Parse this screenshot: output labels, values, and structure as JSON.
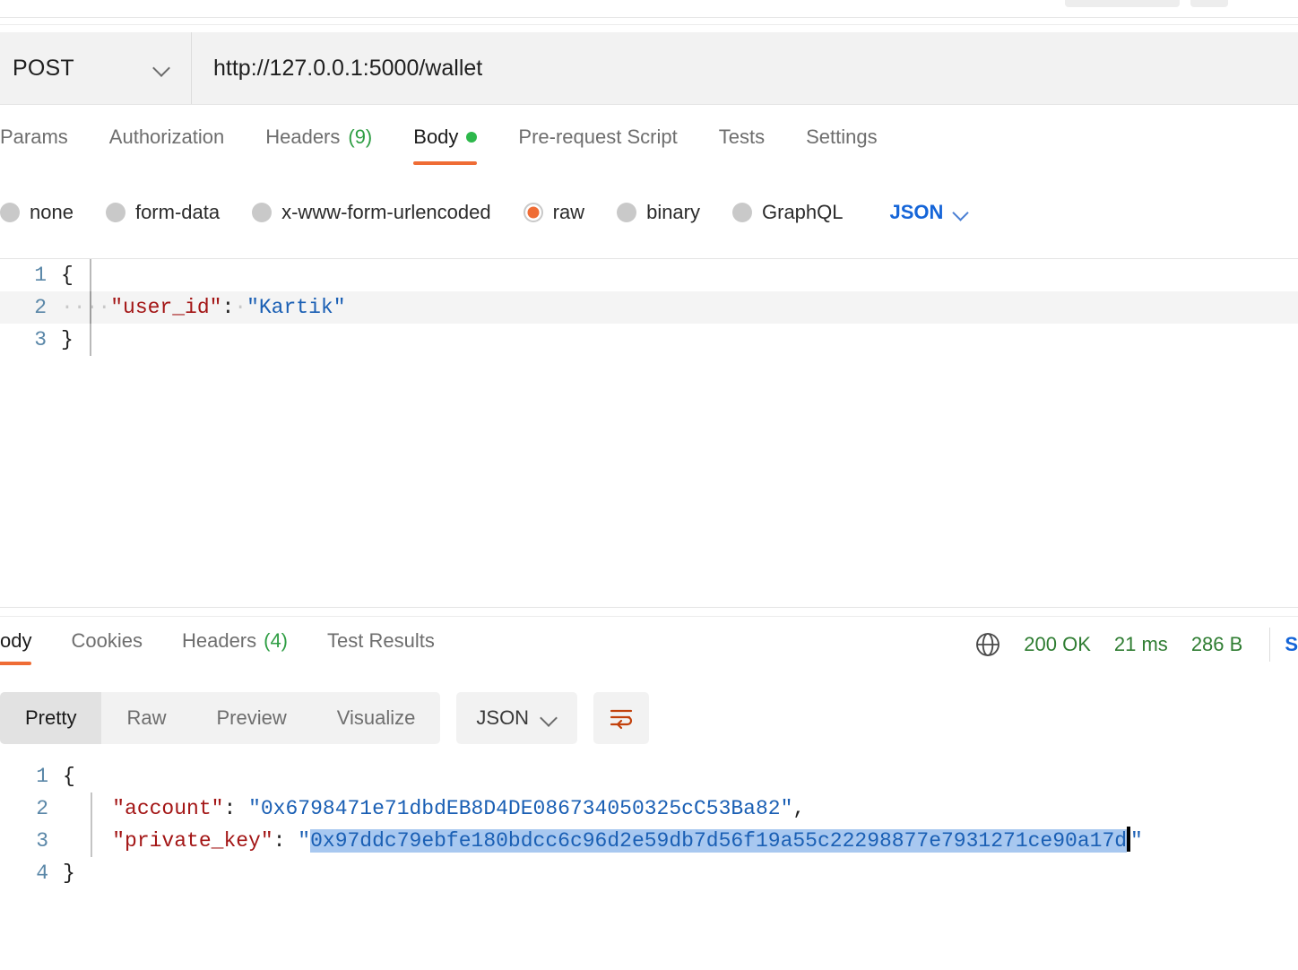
{
  "request": {
    "method": "POST",
    "url": "http://127.0.0.1:5000/wallet",
    "tabs": [
      {
        "label": "Params",
        "count": "",
        "active": false,
        "dot": false
      },
      {
        "label": "Authorization",
        "count": "",
        "active": false,
        "dot": false
      },
      {
        "label": "Headers",
        "count": "(9)",
        "active": false,
        "dot": false
      },
      {
        "label": "Body",
        "count": "",
        "active": true,
        "dot": true
      },
      {
        "label": "Pre-request Script",
        "count": "",
        "active": false,
        "dot": false
      },
      {
        "label": "Tests",
        "count": "",
        "active": false,
        "dot": false
      },
      {
        "label": "Settings",
        "count": "",
        "active": false,
        "dot": false
      }
    ],
    "body_types": [
      {
        "label": "none",
        "checked": false
      },
      {
        "label": "form-data",
        "checked": false
      },
      {
        "label": "x-www-form-urlencoded",
        "checked": false
      },
      {
        "label": "raw",
        "checked": true
      },
      {
        "label": "binary",
        "checked": false
      },
      {
        "label": "GraphQL",
        "checked": false
      }
    ],
    "raw_format": "JSON",
    "body_lines": [
      {
        "no": "1",
        "indent_dots": "",
        "key": "",
        "colon": "",
        "value": "",
        "brace": "{",
        "active": false
      },
      {
        "no": "2",
        "indent_dots": "····",
        "key": "\"user_id\"",
        "colon": ":",
        "value": "\"Kartik\"",
        "brace": "",
        "active": true
      },
      {
        "no": "3",
        "indent_dots": "",
        "key": "",
        "colon": "",
        "value": "",
        "brace": "}",
        "active": false
      }
    ]
  },
  "response": {
    "tabs": [
      {
        "label": "ody",
        "count": "",
        "active": true
      },
      {
        "label": "Cookies",
        "count": "",
        "active": false
      },
      {
        "label": "Headers",
        "count": "(4)",
        "active": false
      },
      {
        "label": "Test Results",
        "count": "",
        "active": false
      }
    ],
    "status": {
      "code": "200 OK",
      "time": "21 ms",
      "size": "286 B",
      "save_example": "S"
    },
    "view_modes": [
      {
        "label": "Pretty",
        "active": true
      },
      {
        "label": "Raw",
        "active": false
      },
      {
        "label": "Preview",
        "active": false
      },
      {
        "label": "Visualize",
        "active": false
      }
    ],
    "format": "JSON",
    "body_lines": [
      {
        "no": "1",
        "brace": "{",
        "key": "",
        "colon": "",
        "value": "",
        "comma": ""
      },
      {
        "no": "2",
        "brace": "",
        "key": "\"account\"",
        "colon": ":",
        "value": "\"0x6798471e71dbdEB8D4DE086734050325cC53Ba82\"",
        "comma": ","
      },
      {
        "no": "3",
        "brace": "",
        "key": "\"private_key\"",
        "colon": ":",
        "value_open_quote": "\"",
        "value_selected": "0x97ddc79ebfe180bdcc6c96d2e59db7d56f19a55c22298877e7931271ce90a17d",
        "value_close_quote": "\"",
        "comma": ""
      },
      {
        "no": "4",
        "brace": "}",
        "key": "",
        "colon": "",
        "value": "",
        "comma": ""
      }
    ]
  },
  "colors": {
    "accent_orange": "#ef6c35",
    "link_blue": "#1565d8",
    "success_green": "#2f7d32",
    "selection_blue": "#a8c8f0",
    "json_key_red": "#a31515",
    "json_string_blue": "#1a5fb4"
  }
}
